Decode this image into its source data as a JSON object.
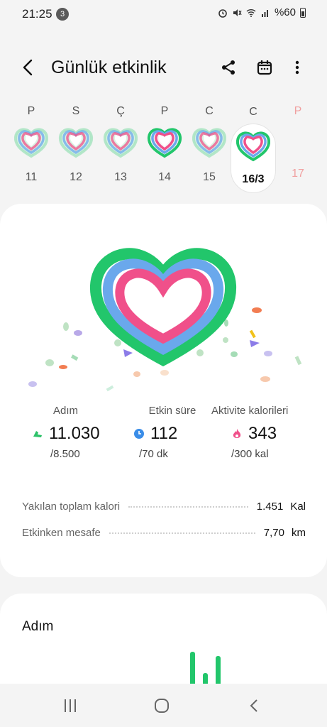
{
  "status_bar": {
    "time": "21:25",
    "notification_count": "3",
    "battery": "%60"
  },
  "header": {
    "title": "Günlük etkinlik"
  },
  "days": [
    {
      "letter": "P",
      "date": "11",
      "selected": false,
      "future": false
    },
    {
      "letter": "S",
      "date": "12",
      "selected": false,
      "future": false
    },
    {
      "letter": "Ç",
      "date": "13",
      "selected": false,
      "future": false
    },
    {
      "letter": "P",
      "date": "14",
      "selected": false,
      "future": false
    },
    {
      "letter": "C",
      "date": "15",
      "selected": false,
      "future": false
    },
    {
      "letter": "C",
      "date": "16/3",
      "selected": true,
      "future": false
    },
    {
      "letter": "P",
      "date": "17",
      "selected": false,
      "future": true
    }
  ],
  "metrics": {
    "steps": {
      "label": "Adım",
      "value": "11.030",
      "goal": "/8.500",
      "color": "#2ec26a",
      "icon": "shoe-icon"
    },
    "active_time": {
      "label": "Etkin süre",
      "value": "112",
      "goal": "/70 dk",
      "color": "#3a8de8",
      "icon": "clock-icon"
    },
    "activity_calories": {
      "label": "Aktivite kalorileri",
      "value": "343",
      "goal": "/300 kal",
      "color": "#f0508a",
      "icon": "flame-icon"
    }
  },
  "summary_rows": [
    {
      "label": "Yakılan toplam kalori",
      "value": "1.451",
      "unit": "Kal"
    },
    {
      "label": "Etkinken mesafe",
      "value": "7,70",
      "unit": "km"
    }
  ],
  "steps_card": {
    "title": "Adım"
  },
  "colors": {
    "ring_green": "#22c66b",
    "ring_blue": "#6aa8ec",
    "ring_pink": "#f0508a",
    "accent_future": "#e77"
  }
}
